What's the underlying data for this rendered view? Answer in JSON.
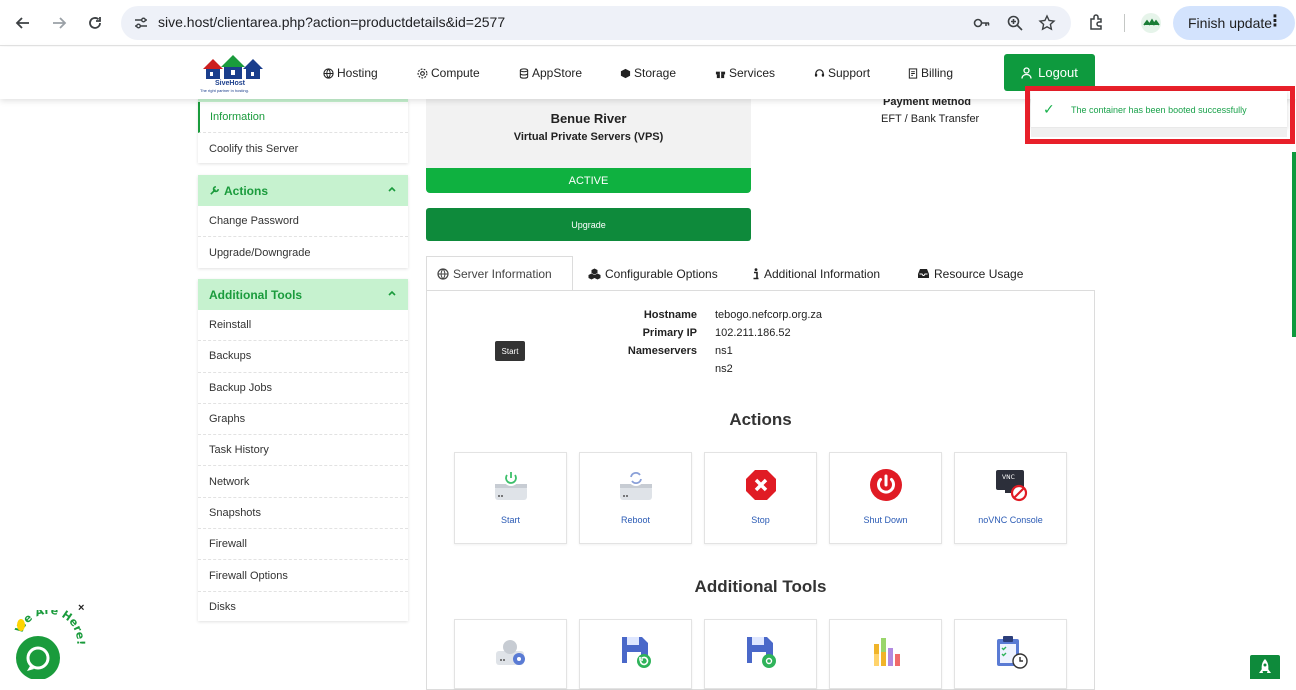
{
  "browser": {
    "url": "sive.host/clientarea.php?action=productdetails&id=2577",
    "finish_update_label": "Finish update"
  },
  "header": {
    "brand": "SiveHost",
    "tagline": "The right partner in hosting.",
    "menu": [
      {
        "label": "Hosting",
        "icon": "globe-icon"
      },
      {
        "label": "Compute",
        "icon": "gear-icon"
      },
      {
        "label": "AppStore",
        "icon": "database-icon"
      },
      {
        "label": "Storage",
        "icon": "cube-icon"
      },
      {
        "label": "Services",
        "icon": "gift-icon"
      },
      {
        "label": "Support",
        "icon": "support-icon"
      },
      {
        "label": "Billing",
        "icon": "billing-icon"
      }
    ],
    "logout_label": "Logout"
  },
  "toast": {
    "message": "The container has been booted successfully"
  },
  "sidebar": {
    "top_items": [
      "Information",
      "Coolify this Server"
    ],
    "actions": {
      "title": "Actions",
      "items": [
        "Change Password",
        "Upgrade/Downgrade"
      ]
    },
    "additional_tools": {
      "title": "Additional Tools",
      "items": [
        "Reinstall",
        "Backups",
        "Backup Jobs",
        "Graphs",
        "Task History",
        "Network",
        "Snapshots",
        "Firewall",
        "Firewall Options",
        "Disks"
      ]
    }
  },
  "server": {
    "name": "Benue River",
    "type": "Virtual Private Servers (VPS)",
    "status": "ACTIVE",
    "upgrade_label": "Upgrade",
    "payment_method_label": "Payment Method",
    "payment_method_value": "EFT / Bank Transfer"
  },
  "tabs": [
    {
      "label": "Server Information",
      "icon": "globe-icon"
    },
    {
      "label": "Configurable Options",
      "icon": "cubes-icon"
    },
    {
      "label": "Additional Information",
      "icon": "info-icon"
    },
    {
      "label": "Resource Usage",
      "icon": "inbox-icon"
    }
  ],
  "server_info": {
    "hostname_label": "Hostname",
    "hostname_value": "tebogo.nefcorp.org.za",
    "primary_ip_label": "Primary IP",
    "primary_ip_value": "102.211.186.52",
    "nameservers_label": "Nameservers",
    "ns1": "ns1",
    "ns2": "ns2",
    "tooltip": "Start"
  },
  "actions_section": {
    "title": "Actions",
    "buttons": [
      "Start",
      "Reboot",
      "Stop",
      "Shut Down",
      "noVNC Console"
    ]
  },
  "tools_section": {
    "title": "Additional Tools"
  },
  "widgets": {
    "chat_text": "We Are Here!",
    "chat_close": "×"
  }
}
